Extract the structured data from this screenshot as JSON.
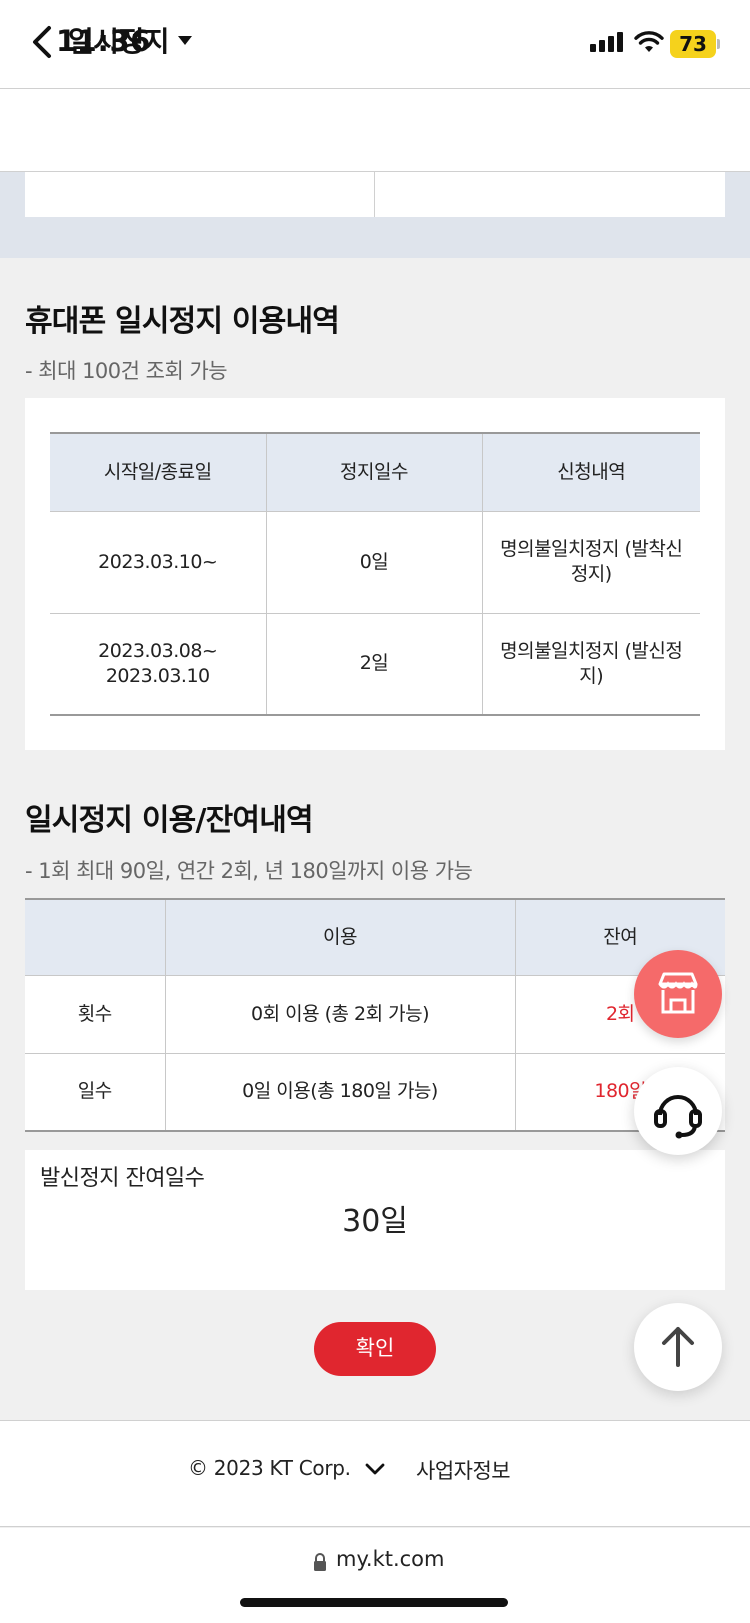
{
  "status_bar": {
    "time": "11:36",
    "battery": "73"
  },
  "header": {
    "title": "일시정지"
  },
  "history": {
    "title": "휴대폰 일시정지 이용내역",
    "note": "- 최대 100건 조회 가능",
    "columns": [
      "시작일/종료일",
      "정지일수",
      "신청내역"
    ],
    "rows": [
      {
        "date_line1": "2023.03.10~",
        "date_line2": "",
        "days": "0일",
        "type": "명의불일치정지 (발착신정지)"
      },
      {
        "date_line1": "2023.03.08~",
        "date_line2": "2023.03.10",
        "days": "2일",
        "type": "명의불일치정지 (발신정지)"
      }
    ]
  },
  "usage": {
    "title": "일시정지 이용/잔여내역",
    "note": "- 1회 최대 90일, 연간 2회, 년 180일까지 이용 가능",
    "columns": [
      "",
      "이용",
      "잔여"
    ],
    "rows": [
      {
        "label": "횟수",
        "used": "0회 이용 (총 2회 가능)",
        "remaining": "2회"
      },
      {
        "label": "일수",
        "used": "0일 이용(총 180일 가능)",
        "remaining": "180일"
      }
    ]
  },
  "outgoing_remaining": {
    "label": "발신정지 잔여일수",
    "value": "30일"
  },
  "confirm_label": "확인",
  "footer": {
    "copyright": "© 2023 KT Corp.",
    "business_info": "사업자정보"
  },
  "browser": {
    "url": "my.kt.com"
  },
  "colors": {
    "accent_red": "#e0262f",
    "table_header_bg": "#e3e9f2",
    "store_fab": "#f56a6a"
  }
}
